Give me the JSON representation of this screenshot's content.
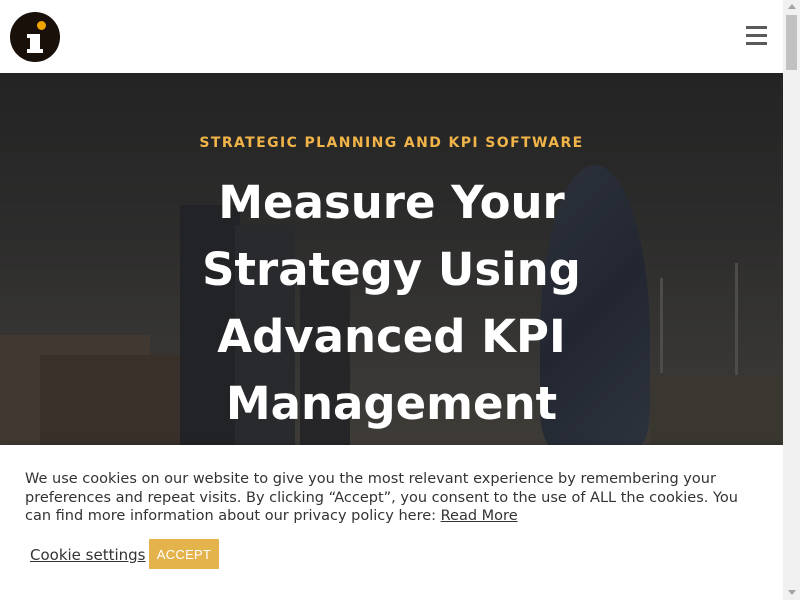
{
  "header": {
    "logo_icon": "info-i-logo",
    "menu_icon": "hamburger-menu-icon"
  },
  "hero": {
    "eyebrow": "STRATEGIC PLANNING AND KPI SOFTWARE",
    "headline_lines": [
      "Measure Your",
      "Strategy Using",
      "Advanced KPI",
      "Management"
    ]
  },
  "cookie_banner": {
    "message": "We use cookies on our website to give you the most relevant experience by remembering your preferences and repeat visits. By clicking “Accept”, you consent to the use of ALL the cookies. You can find more information about our privacy policy here: ",
    "read_more_label": "Read More",
    "settings_label": "Cookie settings",
    "accept_label": "ACCEPT"
  },
  "colors": {
    "accent": "#e5b34c",
    "eyebrow": "#f0b449",
    "logo_dark": "#1a100a",
    "logo_dot": "#f0a500"
  }
}
